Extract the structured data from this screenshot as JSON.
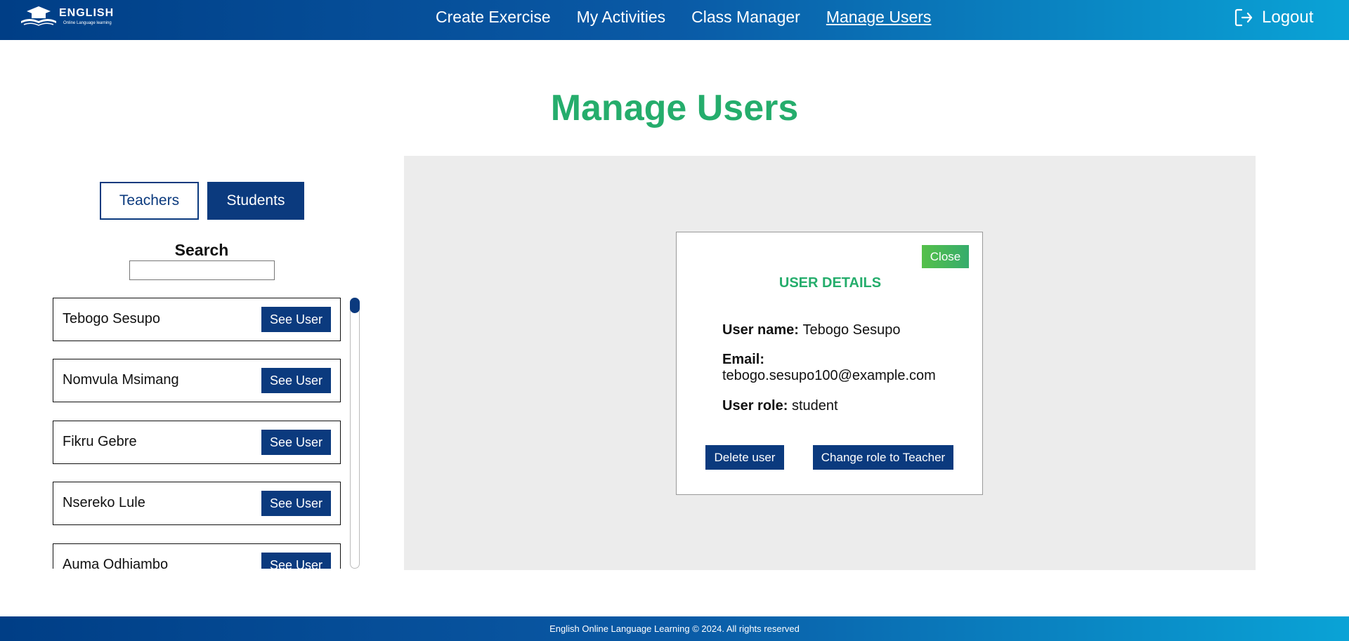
{
  "header": {
    "logo_title": "ENGLISH",
    "logo_subtitle": "Online Language learning",
    "nav": [
      {
        "label": "Create Exercise"
      },
      {
        "label": "My Activities"
      },
      {
        "label": "Class Manager"
      },
      {
        "label": "Manage Users",
        "active": true
      }
    ],
    "logout_label": "Logout"
  },
  "page_title": "Manage Users",
  "tabs": {
    "teachers_label": "Teachers",
    "students_label": "Students",
    "selected": "Students"
  },
  "search": {
    "label": "Search",
    "value": ""
  },
  "users": [
    {
      "name": "Tebogo Sesupo",
      "button": "See User"
    },
    {
      "name": "Nomvula Msimang",
      "button": "See User"
    },
    {
      "name": "Fikru Gebre",
      "button": "See User"
    },
    {
      "name": "Nsereko Lule",
      "button": "See User"
    },
    {
      "name": "Auma Odhiambo",
      "button": "See User"
    }
  ],
  "details": {
    "close_label": "Close",
    "title": "USER DETAILS",
    "username_label": "User name:",
    "username_value": "Tebogo Sesupo",
    "email_label": "Email:",
    "email_value": "tebogo.sesupo100@example.com",
    "role_label": "User role:",
    "role_value": "student",
    "delete_label": "Delete user",
    "change_role_label": "Change role to Teacher"
  },
  "footer_text": "English Online Language Learning © 2024. All rights reserved",
  "colors": {
    "primary": "#0b3a7e",
    "accent_green": "#25ad6c",
    "panel_bg": "#ececec"
  }
}
